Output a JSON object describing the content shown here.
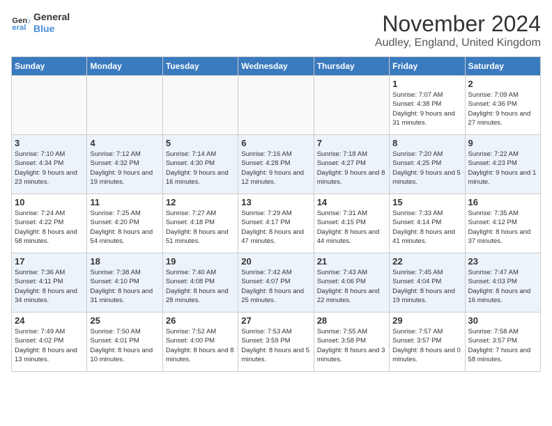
{
  "logo": {
    "line1": "General",
    "line2": "Blue"
  },
  "title": "November 2024",
  "location": "Audley, England, United Kingdom",
  "days_of_week": [
    "Sunday",
    "Monday",
    "Tuesday",
    "Wednesday",
    "Thursday",
    "Friday",
    "Saturday"
  ],
  "weeks": [
    [
      {
        "day": "",
        "empty": true
      },
      {
        "day": "",
        "empty": true
      },
      {
        "day": "",
        "empty": true
      },
      {
        "day": "",
        "empty": true
      },
      {
        "day": "",
        "empty": true
      },
      {
        "day": "1",
        "sunrise": "7:07 AM",
        "sunset": "4:38 PM",
        "daylight": "9 hours and 31 minutes."
      },
      {
        "day": "2",
        "sunrise": "7:09 AM",
        "sunset": "4:36 PM",
        "daylight": "9 hours and 27 minutes."
      }
    ],
    [
      {
        "day": "3",
        "sunrise": "7:10 AM",
        "sunset": "4:34 PM",
        "daylight": "9 hours and 23 minutes."
      },
      {
        "day": "4",
        "sunrise": "7:12 AM",
        "sunset": "4:32 PM",
        "daylight": "9 hours and 19 minutes."
      },
      {
        "day": "5",
        "sunrise": "7:14 AM",
        "sunset": "4:30 PM",
        "daylight": "9 hours and 16 minutes."
      },
      {
        "day": "6",
        "sunrise": "7:16 AM",
        "sunset": "4:28 PM",
        "daylight": "9 hours and 12 minutes."
      },
      {
        "day": "7",
        "sunrise": "7:18 AM",
        "sunset": "4:27 PM",
        "daylight": "9 hours and 8 minutes."
      },
      {
        "day": "8",
        "sunrise": "7:20 AM",
        "sunset": "4:25 PM",
        "daylight": "9 hours and 5 minutes."
      },
      {
        "day": "9",
        "sunrise": "7:22 AM",
        "sunset": "4:23 PM",
        "daylight": "9 hours and 1 minute."
      }
    ],
    [
      {
        "day": "10",
        "sunrise": "7:24 AM",
        "sunset": "4:22 PM",
        "daylight": "8 hours and 58 minutes."
      },
      {
        "day": "11",
        "sunrise": "7:25 AM",
        "sunset": "4:20 PM",
        "daylight": "8 hours and 54 minutes."
      },
      {
        "day": "12",
        "sunrise": "7:27 AM",
        "sunset": "4:18 PM",
        "daylight": "8 hours and 51 minutes."
      },
      {
        "day": "13",
        "sunrise": "7:29 AM",
        "sunset": "4:17 PM",
        "daylight": "8 hours and 47 minutes."
      },
      {
        "day": "14",
        "sunrise": "7:31 AM",
        "sunset": "4:15 PM",
        "daylight": "8 hours and 44 minutes."
      },
      {
        "day": "15",
        "sunrise": "7:33 AM",
        "sunset": "4:14 PM",
        "daylight": "8 hours and 41 minutes."
      },
      {
        "day": "16",
        "sunrise": "7:35 AM",
        "sunset": "4:12 PM",
        "daylight": "8 hours and 37 minutes."
      }
    ],
    [
      {
        "day": "17",
        "sunrise": "7:36 AM",
        "sunset": "4:11 PM",
        "daylight": "8 hours and 34 minutes."
      },
      {
        "day": "18",
        "sunrise": "7:38 AM",
        "sunset": "4:10 PM",
        "daylight": "8 hours and 31 minutes."
      },
      {
        "day": "19",
        "sunrise": "7:40 AM",
        "sunset": "4:08 PM",
        "daylight": "8 hours and 28 minutes."
      },
      {
        "day": "20",
        "sunrise": "7:42 AM",
        "sunset": "4:07 PM",
        "daylight": "8 hours and 25 minutes."
      },
      {
        "day": "21",
        "sunrise": "7:43 AM",
        "sunset": "4:06 PM",
        "daylight": "8 hours and 22 minutes."
      },
      {
        "day": "22",
        "sunrise": "7:45 AM",
        "sunset": "4:04 PM",
        "daylight": "8 hours and 19 minutes."
      },
      {
        "day": "23",
        "sunrise": "7:47 AM",
        "sunset": "4:03 PM",
        "daylight": "8 hours and 16 minutes."
      }
    ],
    [
      {
        "day": "24",
        "sunrise": "7:49 AM",
        "sunset": "4:02 PM",
        "daylight": "8 hours and 13 minutes."
      },
      {
        "day": "25",
        "sunrise": "7:50 AM",
        "sunset": "4:01 PM",
        "daylight": "8 hours and 10 minutes."
      },
      {
        "day": "26",
        "sunrise": "7:52 AM",
        "sunset": "4:00 PM",
        "daylight": "8 hours and 8 minutes."
      },
      {
        "day": "27",
        "sunrise": "7:53 AM",
        "sunset": "3:59 PM",
        "daylight": "8 hours and 5 minutes."
      },
      {
        "day": "28",
        "sunrise": "7:55 AM",
        "sunset": "3:58 PM",
        "daylight": "8 hours and 3 minutes."
      },
      {
        "day": "29",
        "sunrise": "7:57 AM",
        "sunset": "3:57 PM",
        "daylight": "8 hours and 0 minutes."
      },
      {
        "day": "30",
        "sunrise": "7:58 AM",
        "sunset": "3:57 PM",
        "daylight": "7 hours and 58 minutes."
      }
    ]
  ]
}
